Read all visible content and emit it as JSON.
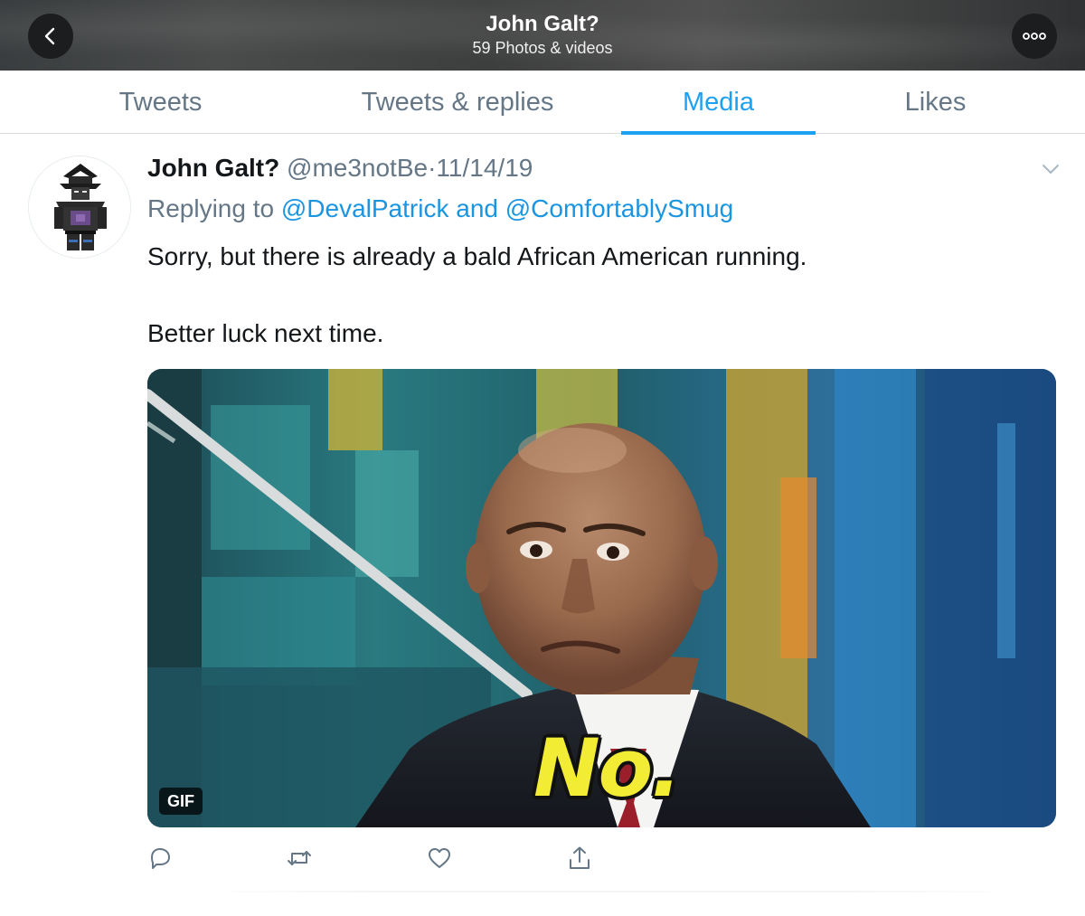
{
  "header": {
    "title": "John Galt?",
    "subtitle": "59 Photos & videos",
    "back_icon": "chevron-left-icon",
    "more_icon": "more-dots-icon"
  },
  "tabs": [
    {
      "label": "Tweets",
      "active": false
    },
    {
      "label": "Tweets & replies",
      "active": false
    },
    {
      "label": "Media",
      "active": true
    },
    {
      "label": "Likes",
      "active": false
    }
  ],
  "tweet": {
    "author_name": "John Galt?",
    "handle": "@me3notBe",
    "separator": "·",
    "date": "11/14/19",
    "reply_prefix": "Replying to",
    "reply_to": [
      "@DevalPatrick",
      "@ComfortablySmug"
    ],
    "reply_joiner": "and",
    "text_line1": "Sorry, but there is already a bald African American running.",
    "text_line2": "Better luck next time.",
    "media": {
      "badge": "GIF",
      "caption": "No."
    },
    "actions": [
      "reply-icon",
      "retweet-icon",
      "like-icon",
      "share-icon"
    ]
  },
  "colors": {
    "accent": "#1da1f2",
    "mention": "#1b95e0",
    "secondary_text": "#657786",
    "primary_text": "#14171a"
  }
}
